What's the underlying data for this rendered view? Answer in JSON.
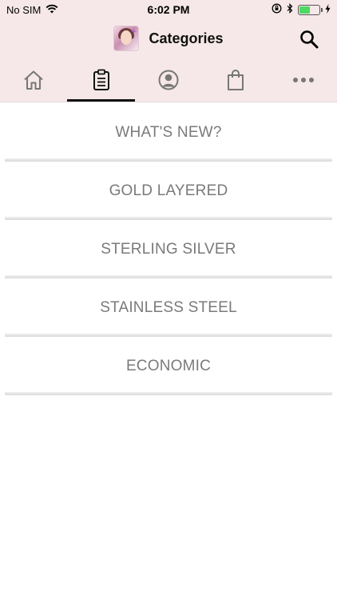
{
  "status_bar": {
    "carrier": "No SIM",
    "time": "6:02 PM",
    "battery_level": 0.55,
    "icons": [
      "wifi-icon",
      "orientation-lock-icon",
      "bluetooth-icon",
      "battery-icon",
      "charging-bolt-icon"
    ]
  },
  "header": {
    "title": "Categories",
    "logo_icon": "brand-logo",
    "search_icon": "search-icon"
  },
  "tabs": [
    {
      "icon": "home-icon",
      "active": false
    },
    {
      "icon": "clipboard-list-icon",
      "active": true
    },
    {
      "icon": "user-profile-icon",
      "active": false
    },
    {
      "icon": "shopping-bag-icon",
      "active": false
    },
    {
      "icon": "more-icon",
      "active": false
    }
  ],
  "categories": [
    {
      "label": "WHAT'S NEW?"
    },
    {
      "label": "GOLD LAYERED"
    },
    {
      "label": "STERLING SILVER"
    },
    {
      "label": "STAINLESS STEEL"
    },
    {
      "label": "ECONOMIC"
    }
  ],
  "colors": {
    "header_bg": "#f6e8e8",
    "category_text": "#7a7a7a",
    "active_tab_indicator": "#111111",
    "battery_fill": "#4cd964"
  }
}
